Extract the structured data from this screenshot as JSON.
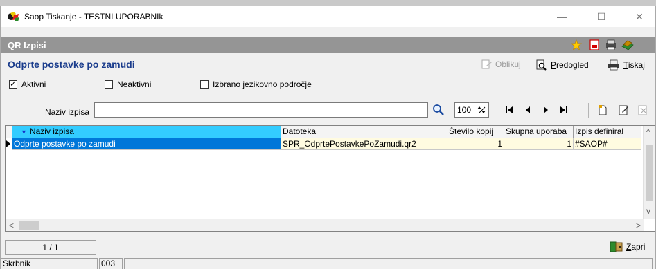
{
  "window": {
    "title": "Saop Tiskanje - TESTNI UPORABNIk"
  },
  "header": {
    "title": "QR Izpisi"
  },
  "subtitle": "Odprte postavke po zamudi",
  "actions": {
    "oblikuj": "Oblikuj",
    "predogled": "Predogled",
    "tiskaj": "Tiskaj"
  },
  "filters": {
    "aktivni": {
      "label": "Aktivni",
      "checked": true
    },
    "neaktivni": {
      "label": "Neaktivni",
      "checked": false
    },
    "jezik": {
      "label": "Izbrano jezikovno področje",
      "checked": false
    }
  },
  "search": {
    "label": "Naziv izpisa",
    "value": "",
    "count": "100"
  },
  "grid": {
    "columns": [
      "Naziv izpisa",
      "Datoteka",
      "Število kopij",
      "Skupna uporaba",
      "Izpis definiral"
    ],
    "rows": [
      {
        "naziv": "Odprte postavke po zamudi",
        "datoteka": "SPR_OdprtePostavkePoZamudi.qr2",
        "kopij": "1",
        "uporaba": "1",
        "definiral": "#SAOP#"
      }
    ]
  },
  "pager": {
    "text": "1 / 1"
  },
  "close_label": "Zapri",
  "status": {
    "user": "Skrbnik",
    "code": "003",
    "message": ""
  },
  "colors": {
    "header_bg": "#959595",
    "selected_col": "#33ccff",
    "selected_row": "#0077d9",
    "subtitle": "#1a3c8c"
  }
}
